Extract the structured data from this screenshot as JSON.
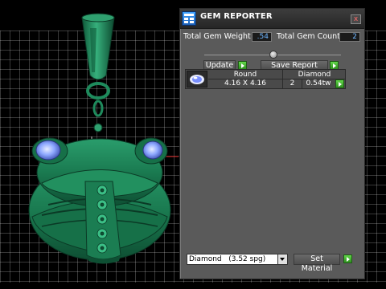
{
  "panel": {
    "title": "GEM REPORTER",
    "close_glyph": "x",
    "total_weight_label": "Total Gem Weight",
    "total_weight_value": ".54",
    "total_count_label": "Total Gem Count",
    "total_count_value": "2",
    "update_label": "Update",
    "save_report_label": "Save Report",
    "table": {
      "header_shape": "Round",
      "header_material": "Diamond",
      "row_size": "4.16 X 4.16",
      "row_count": "2",
      "row_weight": "0.54tw"
    },
    "material_select": "Diamond   (3.52 spg)",
    "set_material_label": "Set Material"
  },
  "colors": {
    "model_green": "#1e8a5c",
    "gem_blue": "#7ea0ff",
    "panel_bg": "#5a5a5a",
    "value_text": "#6fb6ff",
    "go_button": "#3fb52b"
  },
  "icons": {
    "app": "gem-reporter-icon",
    "close": "close-icon",
    "go": "go-arrow-icon",
    "gem_thumb": "round-gem-icon",
    "dropdown": "chevron-down-icon"
  }
}
